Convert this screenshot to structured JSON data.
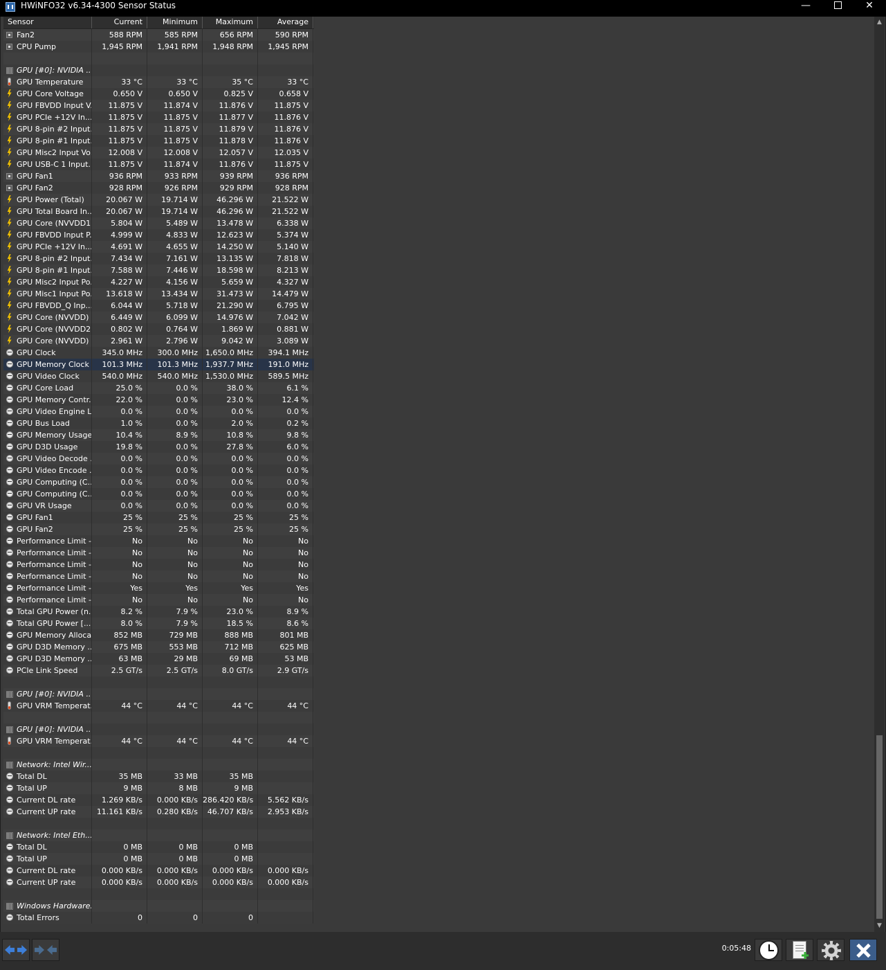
{
  "window": {
    "title": "HWiNFO32 v6.34-4300 Sensor Status",
    "controls": [
      "minimize",
      "maximize",
      "close"
    ]
  },
  "columns": [
    "Sensor",
    "Current",
    "Minimum",
    "Maximum",
    "Average"
  ],
  "rows": [
    {
      "type": "data",
      "icon": "fan-icon",
      "name": "Fan2",
      "cur": "588 RPM",
      "min": "585 RPM",
      "max": "656 RPM",
      "avg": "590 RPM"
    },
    {
      "type": "data",
      "icon": "fan-icon",
      "name": "CPU Pump",
      "cur": "1,945 RPM",
      "min": "1,941 RPM",
      "max": "1,948 RPM",
      "avg": "1,945 RPM"
    },
    {
      "type": "spacer"
    },
    {
      "type": "group",
      "icon": "chip-icon",
      "name": "GPU [#0]: NVIDIA ..."
    },
    {
      "type": "data",
      "icon": "thermometer-icon",
      "name": "GPU Temperature",
      "cur": "33 °C",
      "min": "33 °C",
      "max": "35 °C",
      "avg": "33 °C"
    },
    {
      "type": "data",
      "icon": "voltage-icon",
      "name": "GPU Core Voltage",
      "cur": "0.650 V",
      "min": "0.650 V",
      "max": "0.825 V",
      "avg": "0.658 V"
    },
    {
      "type": "data",
      "icon": "voltage-icon",
      "name": "GPU FBVDD Input V...",
      "cur": "11.875 V",
      "min": "11.874 V",
      "max": "11.876 V",
      "avg": "11.875 V"
    },
    {
      "type": "data",
      "icon": "voltage-icon",
      "name": "GPU PCIe +12V In...",
      "cur": "11.875 V",
      "min": "11.875 V",
      "max": "11.877 V",
      "avg": "11.876 V"
    },
    {
      "type": "data",
      "icon": "voltage-icon",
      "name": "GPU 8-pin #2 Input...",
      "cur": "11.875 V",
      "min": "11.875 V",
      "max": "11.879 V",
      "avg": "11.876 V"
    },
    {
      "type": "data",
      "icon": "voltage-icon",
      "name": "GPU 8-pin #1 Input...",
      "cur": "11.875 V",
      "min": "11.875 V",
      "max": "11.878 V",
      "avg": "11.876 V"
    },
    {
      "type": "data",
      "icon": "voltage-icon",
      "name": "GPU Misc2 Input Vo...",
      "cur": "12.008 V",
      "min": "12.008 V",
      "max": "12.057 V",
      "avg": "12.035 V"
    },
    {
      "type": "data",
      "icon": "voltage-icon",
      "name": "GPU USB-C 1 Input...",
      "cur": "11.875 V",
      "min": "11.874 V",
      "max": "11.876 V",
      "avg": "11.875 V"
    },
    {
      "type": "data",
      "icon": "fan-icon",
      "name": "GPU Fan1",
      "cur": "936 RPM",
      "min": "933 RPM",
      "max": "939 RPM",
      "avg": "936 RPM"
    },
    {
      "type": "data",
      "icon": "fan-icon",
      "name": "GPU Fan2",
      "cur": "928 RPM",
      "min": "926 RPM",
      "max": "929 RPM",
      "avg": "928 RPM"
    },
    {
      "type": "data",
      "icon": "voltage-icon",
      "name": "GPU Power (Total)",
      "cur": "20.067 W",
      "min": "19.714 W",
      "max": "46.296 W",
      "avg": "21.522 W"
    },
    {
      "type": "data",
      "icon": "voltage-icon",
      "name": "GPU Total Board In...",
      "cur": "20.067 W",
      "min": "19.714 W",
      "max": "46.296 W",
      "avg": "21.522 W"
    },
    {
      "type": "data",
      "icon": "voltage-icon",
      "name": "GPU Core (NVVDD1...",
      "cur": "5.804 W",
      "min": "5.489 W",
      "max": "13.478 W",
      "avg": "6.338 W"
    },
    {
      "type": "data",
      "icon": "voltage-icon",
      "name": "GPU FBVDD Input P...",
      "cur": "4.999 W",
      "min": "4.833 W",
      "max": "12.623 W",
      "avg": "5.374 W"
    },
    {
      "type": "data",
      "icon": "voltage-icon",
      "name": "GPU PCIe +12V In...",
      "cur": "4.691 W",
      "min": "4.655 W",
      "max": "14.250 W",
      "avg": "5.140 W"
    },
    {
      "type": "data",
      "icon": "voltage-icon",
      "name": "GPU 8-pin #2 Input...",
      "cur": "7.434 W",
      "min": "7.161 W",
      "max": "13.135 W",
      "avg": "7.818 W"
    },
    {
      "type": "data",
      "icon": "voltage-icon",
      "name": "GPU 8-pin #1 Input...",
      "cur": "7.588 W",
      "min": "7.446 W",
      "max": "18.598 W",
      "avg": "8.213 W"
    },
    {
      "type": "data",
      "icon": "voltage-icon",
      "name": "GPU Misc2 Input Po...",
      "cur": "4.227 W",
      "min": "4.156 W",
      "max": "5.659 W",
      "avg": "4.327 W"
    },
    {
      "type": "data",
      "icon": "voltage-icon",
      "name": "GPU Misc1 Input Po...",
      "cur": "13.618 W",
      "min": "13.434 W",
      "max": "31.473 W",
      "avg": "14.479 W"
    },
    {
      "type": "data",
      "icon": "voltage-icon",
      "name": "GPU FBVDD_Q Inp...",
      "cur": "6.044 W",
      "min": "5.718 W",
      "max": "21.290 W",
      "avg": "6.795 W"
    },
    {
      "type": "data",
      "icon": "voltage-icon",
      "name": "GPU Core (NVVDD) ...",
      "cur": "6.449 W",
      "min": "6.099 W",
      "max": "14.976 W",
      "avg": "7.042 W"
    },
    {
      "type": "data",
      "icon": "voltage-icon",
      "name": "GPU Core (NVVDD2...",
      "cur": "0.802 W",
      "min": "0.764 W",
      "max": "1.869 W",
      "avg": "0.881 W"
    },
    {
      "type": "data",
      "icon": "voltage-icon",
      "name": "GPU Core (NVVDD) ...",
      "cur": "2.961 W",
      "min": "2.796 W",
      "max": "9.042 W",
      "avg": "3.089 W"
    },
    {
      "type": "data",
      "icon": "clock-icon",
      "name": "GPU Clock",
      "cur": "345.0 MHz",
      "min": "300.0 MHz",
      "max": "1,650.0 MHz",
      "avg": "394.1 MHz"
    },
    {
      "type": "data",
      "icon": "clock-icon",
      "name": "GPU Memory Clock",
      "cur": "101.3 MHz",
      "min": "101.3 MHz",
      "max": "1,937.7 MHz",
      "avg": "191.0 MHz",
      "selected": true
    },
    {
      "type": "data",
      "icon": "clock-icon",
      "name": "GPU Video Clock",
      "cur": "540.0 MHz",
      "min": "540.0 MHz",
      "max": "1,530.0 MHz",
      "avg": "589.5 MHz"
    },
    {
      "type": "data",
      "icon": "clock-icon",
      "name": "GPU Core Load",
      "cur": "25.0 %",
      "min": "0.0 %",
      "max": "38.0 %",
      "avg": "6.1 %"
    },
    {
      "type": "data",
      "icon": "clock-icon",
      "name": "GPU Memory Contr...",
      "cur": "22.0 %",
      "min": "0.0 %",
      "max": "23.0 %",
      "avg": "12.4 %"
    },
    {
      "type": "data",
      "icon": "clock-icon",
      "name": "GPU Video Engine L...",
      "cur": "0.0 %",
      "min": "0.0 %",
      "max": "0.0 %",
      "avg": "0.0 %"
    },
    {
      "type": "data",
      "icon": "clock-icon",
      "name": "GPU Bus Load",
      "cur": "1.0 %",
      "min": "0.0 %",
      "max": "2.0 %",
      "avg": "0.2 %"
    },
    {
      "type": "data",
      "icon": "clock-icon",
      "name": "GPU Memory Usage",
      "cur": "10.4 %",
      "min": "8.9 %",
      "max": "10.8 %",
      "avg": "9.8 %"
    },
    {
      "type": "data",
      "icon": "clock-icon",
      "name": "GPU D3D Usage",
      "cur": "19.8 %",
      "min": "0.0 %",
      "max": "27.8 %",
      "avg": "6.0 %"
    },
    {
      "type": "data",
      "icon": "clock-icon",
      "name": "GPU Video Decode ...",
      "cur": "0.0 %",
      "min": "0.0 %",
      "max": "0.0 %",
      "avg": "0.0 %"
    },
    {
      "type": "data",
      "icon": "clock-icon",
      "name": "GPU Video Encode ...",
      "cur": "0.0 %",
      "min": "0.0 %",
      "max": "0.0 %",
      "avg": "0.0 %"
    },
    {
      "type": "data",
      "icon": "clock-icon",
      "name": "GPU Computing (C...",
      "cur": "0.0 %",
      "min": "0.0 %",
      "max": "0.0 %",
      "avg": "0.0 %"
    },
    {
      "type": "data",
      "icon": "clock-icon",
      "name": "GPU Computing (C...",
      "cur": "0.0 %",
      "min": "0.0 %",
      "max": "0.0 %",
      "avg": "0.0 %"
    },
    {
      "type": "data",
      "icon": "clock-icon",
      "name": "GPU VR Usage",
      "cur": "0.0 %",
      "min": "0.0 %",
      "max": "0.0 %",
      "avg": "0.0 %"
    },
    {
      "type": "data",
      "icon": "clock-icon",
      "name": "GPU Fan1",
      "cur": "25 %",
      "min": "25 %",
      "max": "25 %",
      "avg": "25 %"
    },
    {
      "type": "data",
      "icon": "clock-icon",
      "name": "GPU Fan2",
      "cur": "25 %",
      "min": "25 %",
      "max": "25 %",
      "avg": "25 %"
    },
    {
      "type": "data",
      "icon": "clock-icon",
      "name": "Performance Limit -...",
      "cur": "No",
      "min": "No",
      "max": "No",
      "avg": "No"
    },
    {
      "type": "data",
      "icon": "clock-icon",
      "name": "Performance Limit -...",
      "cur": "No",
      "min": "No",
      "max": "No",
      "avg": "No"
    },
    {
      "type": "data",
      "icon": "clock-icon",
      "name": "Performance Limit -...",
      "cur": "No",
      "min": "No",
      "max": "No",
      "avg": "No"
    },
    {
      "type": "data",
      "icon": "clock-icon",
      "name": "Performance Limit -...",
      "cur": "No",
      "min": "No",
      "max": "No",
      "avg": "No"
    },
    {
      "type": "data",
      "icon": "clock-icon",
      "name": "Performance Limit -...",
      "cur": "Yes",
      "min": "Yes",
      "max": "Yes",
      "avg": "Yes"
    },
    {
      "type": "data",
      "icon": "clock-icon",
      "name": "Performance Limit -...",
      "cur": "No",
      "min": "No",
      "max": "No",
      "avg": "No"
    },
    {
      "type": "data",
      "icon": "clock-icon",
      "name": "Total GPU Power (n...",
      "cur": "8.2 %",
      "min": "7.9 %",
      "max": "23.0 %",
      "avg": "8.9 %"
    },
    {
      "type": "data",
      "icon": "clock-icon",
      "name": "Total GPU Power [...",
      "cur": "8.0 %",
      "min": "7.9 %",
      "max": "18.5 %",
      "avg": "8.6 %"
    },
    {
      "type": "data",
      "icon": "clock-icon",
      "name": "GPU Memory Alloca...",
      "cur": "852 MB",
      "min": "729 MB",
      "max": "888 MB",
      "avg": "801 MB"
    },
    {
      "type": "data",
      "icon": "clock-icon",
      "name": "GPU D3D Memory ...",
      "cur": "675 MB",
      "min": "553 MB",
      "max": "712 MB",
      "avg": "625 MB"
    },
    {
      "type": "data",
      "icon": "clock-icon",
      "name": "GPU D3D Memory ...",
      "cur": "63 MB",
      "min": "29 MB",
      "max": "69 MB",
      "avg": "53 MB"
    },
    {
      "type": "data",
      "icon": "clock-icon",
      "name": "PCIe Link Speed",
      "cur": "2.5 GT/s",
      "min": "2.5 GT/s",
      "max": "8.0 GT/s",
      "avg": "2.9 GT/s"
    },
    {
      "type": "spacer"
    },
    {
      "type": "group",
      "icon": "chip-icon",
      "name": "GPU [#0]: NVIDIA ..."
    },
    {
      "type": "data",
      "icon": "thermometer-icon",
      "name": "GPU VRM Temperat...",
      "cur": "44 °C",
      "min": "44 °C",
      "max": "44 °C",
      "avg": "44 °C"
    },
    {
      "type": "spacer"
    },
    {
      "type": "group",
      "icon": "chip-icon",
      "name": "GPU [#0]: NVIDIA ..."
    },
    {
      "type": "data",
      "icon": "thermometer-icon",
      "name": "GPU VRM Temperat...",
      "cur": "44 °C",
      "min": "44 °C",
      "max": "44 °C",
      "avg": "44 °C"
    },
    {
      "type": "spacer"
    },
    {
      "type": "group",
      "icon": "chip-icon",
      "name": "Network: Intel Wir..."
    },
    {
      "type": "data",
      "icon": "clock-icon",
      "name": "Total DL",
      "cur": "35 MB",
      "min": "33 MB",
      "max": "35 MB",
      "avg": ""
    },
    {
      "type": "data",
      "icon": "clock-icon",
      "name": "Total UP",
      "cur": "9 MB",
      "min": "8 MB",
      "max": "9 MB",
      "avg": ""
    },
    {
      "type": "data",
      "icon": "clock-icon",
      "name": "Current DL rate",
      "cur": "1.269 KB/s",
      "min": "0.000 KB/s",
      "max": "286.420 KB/s",
      "avg": "5.562 KB/s"
    },
    {
      "type": "data",
      "icon": "clock-icon",
      "name": "Current UP rate",
      "cur": "11.161 KB/s",
      "min": "0.280 KB/s",
      "max": "46.707 KB/s",
      "avg": "2.953 KB/s"
    },
    {
      "type": "spacer"
    },
    {
      "type": "group",
      "icon": "chip-icon",
      "name": "Network: Intel Eth..."
    },
    {
      "type": "data",
      "icon": "clock-icon",
      "name": "Total DL",
      "cur": "0 MB",
      "min": "0 MB",
      "max": "0 MB",
      "avg": ""
    },
    {
      "type": "data",
      "icon": "clock-icon",
      "name": "Total UP",
      "cur": "0 MB",
      "min": "0 MB",
      "max": "0 MB",
      "avg": ""
    },
    {
      "type": "data",
      "icon": "clock-icon",
      "name": "Current DL rate",
      "cur": "0.000 KB/s",
      "min": "0.000 KB/s",
      "max": "0.000 KB/s",
      "avg": "0.000 KB/s"
    },
    {
      "type": "data",
      "icon": "clock-icon",
      "name": "Current UP rate",
      "cur": "0.000 KB/s",
      "min": "0.000 KB/s",
      "max": "0.000 KB/s",
      "avg": "0.000 KB/s"
    },
    {
      "type": "spacer"
    },
    {
      "type": "group",
      "icon": "chip-icon",
      "name": "Windows Hardware..."
    },
    {
      "type": "data",
      "icon": "clock-icon",
      "name": "Total Errors",
      "cur": "0",
      "min": "0",
      "max": "0",
      "avg": ""
    }
  ],
  "footer": {
    "timer": "0:05:48",
    "buttons": [
      "expand-icon",
      "collapse-icon",
      "clock-icon",
      "report-icon",
      "settings-icon",
      "close-icon"
    ]
  },
  "colors": {
    "background": "#3a3a3a",
    "selected_row": "#283448",
    "accent_blue": "#3d7fd9",
    "voltage_icon": "#f0c000"
  }
}
